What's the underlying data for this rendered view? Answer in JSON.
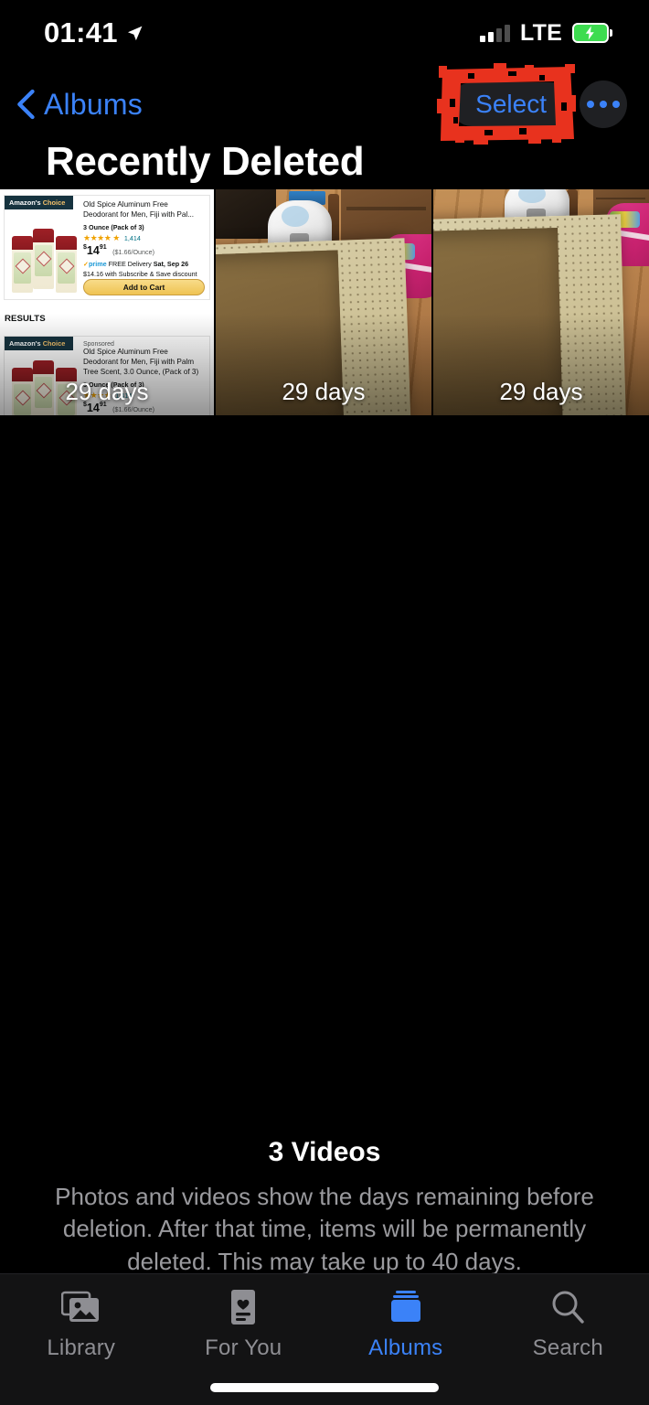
{
  "status_bar": {
    "time": "01:41",
    "location_icon": "location-arrow-icon",
    "signal_icon": "cellular-signal-icon",
    "carrier_type": "LTE",
    "battery_icon": "battery-charging-icon"
  },
  "nav": {
    "back_icon": "chevron-left-icon",
    "back_label": "Albums",
    "select_label": "Select",
    "more_icon": "ellipsis-icon",
    "annotation_color": "#e8321e"
  },
  "page_title": "Recently Deleted",
  "thumbnails": [
    {
      "days_label": "29 days",
      "kind": "screen-recording-amazon",
      "amazon": {
        "badge_prefix": "Amazon's",
        "badge_suffix": "Choice",
        "title": "Old Spice Aluminum Free Deodorant for Men, Fiji with Pal...",
        "size_line": "3 Ounce (Pack of 3)",
        "rating_stars": "★★★★",
        "rating_half": "★",
        "rating_count": "1,414",
        "price_main": "14",
        "price_cents": "91",
        "price_per_unit": "($1.66/Ounce)",
        "prime_check": "✓",
        "prime_word": "prime",
        "delivery_text": "FREE Delivery ",
        "delivery_date": "Sat, Sep 26",
        "subscribe_line": "$14.16 with Subscribe & Save discount",
        "add_to_cart": "Add to Cart",
        "results_header": "RESULTS",
        "sponsored_label": "Sponsored",
        "title2": "Old Spice Aluminum Free Deodorant for Men, Fiji with Palm Tree Scent, 3.0 Ounce, (Pack of 3)",
        "size_line2": "3 Ounce (Pack of 3)",
        "rating_count2": "1,414",
        "price_main2": "14",
        "price_cents2": "91",
        "price_per_unit2": "($1.66/Ounce)"
      }
    },
    {
      "days_label": "29 days",
      "kind": "room-rug-photo"
    },
    {
      "days_label": "29 days",
      "kind": "room-rug-photo"
    }
  ],
  "footer": {
    "count": "3 Videos",
    "description": "Photos and videos show the days remaining before deletion. After that time, items will be permanently deleted. This may take up to 40 days."
  },
  "tabbar": {
    "items": [
      {
        "label": "Library",
        "icon": "photo-stack-icon",
        "active": false
      },
      {
        "label": "For You",
        "icon": "heart-card-icon",
        "active": false
      },
      {
        "label": "Albums",
        "icon": "albums-icon",
        "active": true
      },
      {
        "label": "Search",
        "icon": "magnifier-icon",
        "active": false
      }
    ],
    "active_color": "#3b82f8",
    "inactive_color": "#8e8e93"
  }
}
